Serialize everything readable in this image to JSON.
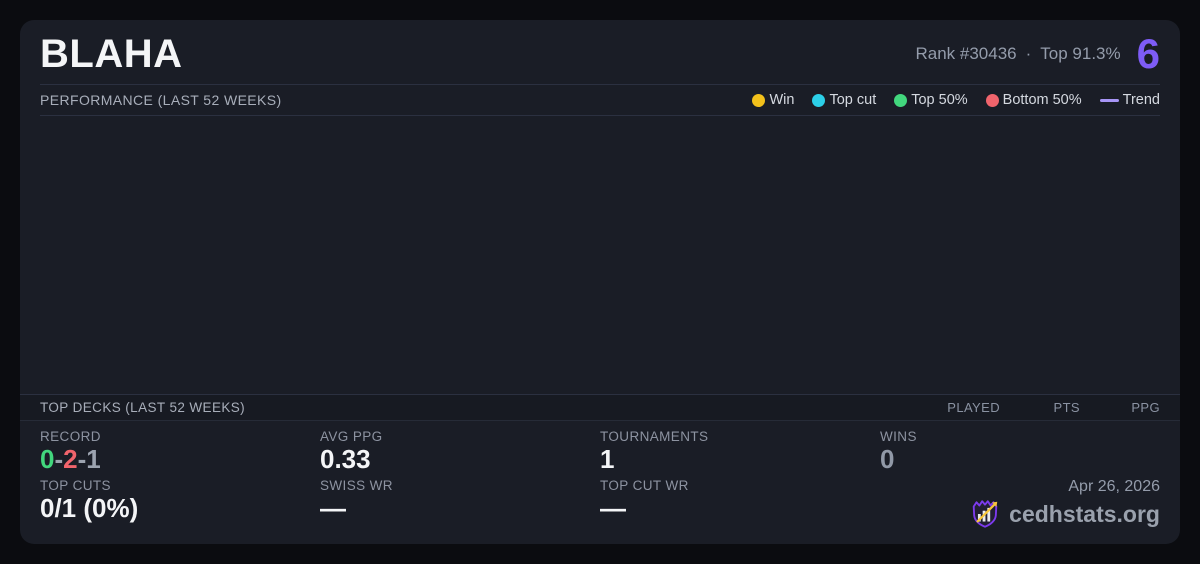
{
  "header": {
    "title": "BLAHA",
    "rank": "Rank #30436",
    "separator": "·",
    "top_percent": "Top 91.3%",
    "count": "6",
    "count_color": "#7e5cf6"
  },
  "performance": {
    "title": "PERFORMANCE (LAST 52 WEEKS)",
    "legend": [
      {
        "label": "Win",
        "color": "#f3c11b"
      },
      {
        "label": "Top cut",
        "color": "#2ccfe8"
      },
      {
        "label": "Top 50%",
        "color": "#42d77d"
      },
      {
        "label": "Bottom 50%",
        "color": "#f0646c"
      },
      {
        "label": "Trend",
        "color": "#a795f5"
      }
    ],
    "chart_note": "empty"
  },
  "top_decks": {
    "title": "TOP DECKS (LAST 52 WEEKS)",
    "columns": [
      "PLAYED",
      "PTS",
      "PPG"
    ],
    "rows": []
  },
  "stats": {
    "record": {
      "label": "RECORD",
      "wins": "0",
      "losses": "2",
      "draws": "1",
      "sep": "-",
      "win_color": "#42d77d",
      "loss_color": "#f0646c",
      "draw_color": "#9ca3af"
    },
    "avg_ppg": {
      "label": "AVG PPG",
      "value": "0.33"
    },
    "tournaments": {
      "label": "TOURNAMENTS",
      "value": "1"
    },
    "wins": {
      "label": "WINS",
      "value": "0"
    },
    "top_cuts": {
      "label": "TOP CUTS",
      "value": "0/1 (0%)"
    },
    "swiss_wr": {
      "label": "SWISS WR",
      "value": "—"
    },
    "top_cut_wr": {
      "label": "TOP CUT WR",
      "value": "—"
    }
  },
  "footer": {
    "date": "Apr 26, 2026",
    "brand": "cedhstats.org"
  }
}
